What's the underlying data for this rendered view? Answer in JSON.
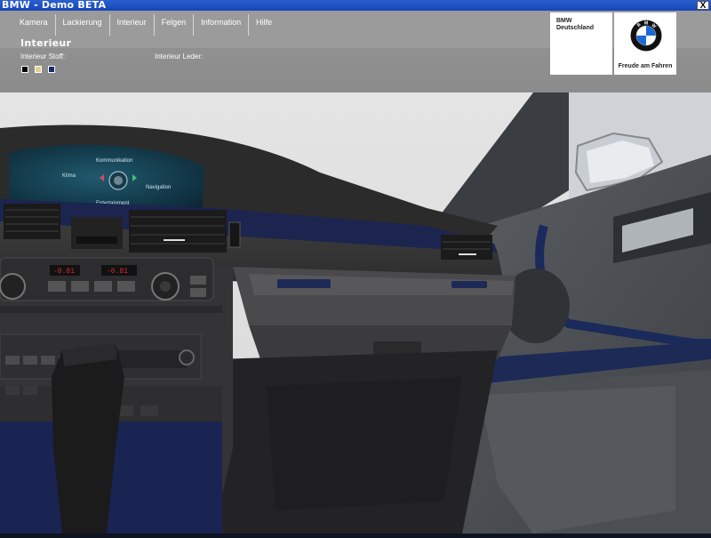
{
  "window": {
    "title": "BMW - Demo BETA",
    "close_label": "X"
  },
  "nav": {
    "tabs": [
      "Kamera",
      "Lackierung",
      "Interieur",
      "Felgen",
      "Information",
      "Hilfe"
    ]
  },
  "section": {
    "title": "Interieur",
    "fabric_label": "Interieur Stoff:",
    "leather_label": "Interieur Leder:",
    "fabric_swatches": [
      "#000000",
      "#e6cf8a",
      "#1c2a6a"
    ]
  },
  "brand": {
    "name_line1": "BMW",
    "name_line2": "Deutschland",
    "logo_letters": [
      "B",
      "M",
      "W"
    ],
    "slogan": "Freude am Fahren",
    "blue": "#1c69d4"
  },
  "scene": {
    "screen_labels": [
      "Kommunikation",
      "Klima",
      "Navigation",
      "Entertainment"
    ],
    "radio_displays": [
      "-0.81",
      "-0.81"
    ]
  }
}
